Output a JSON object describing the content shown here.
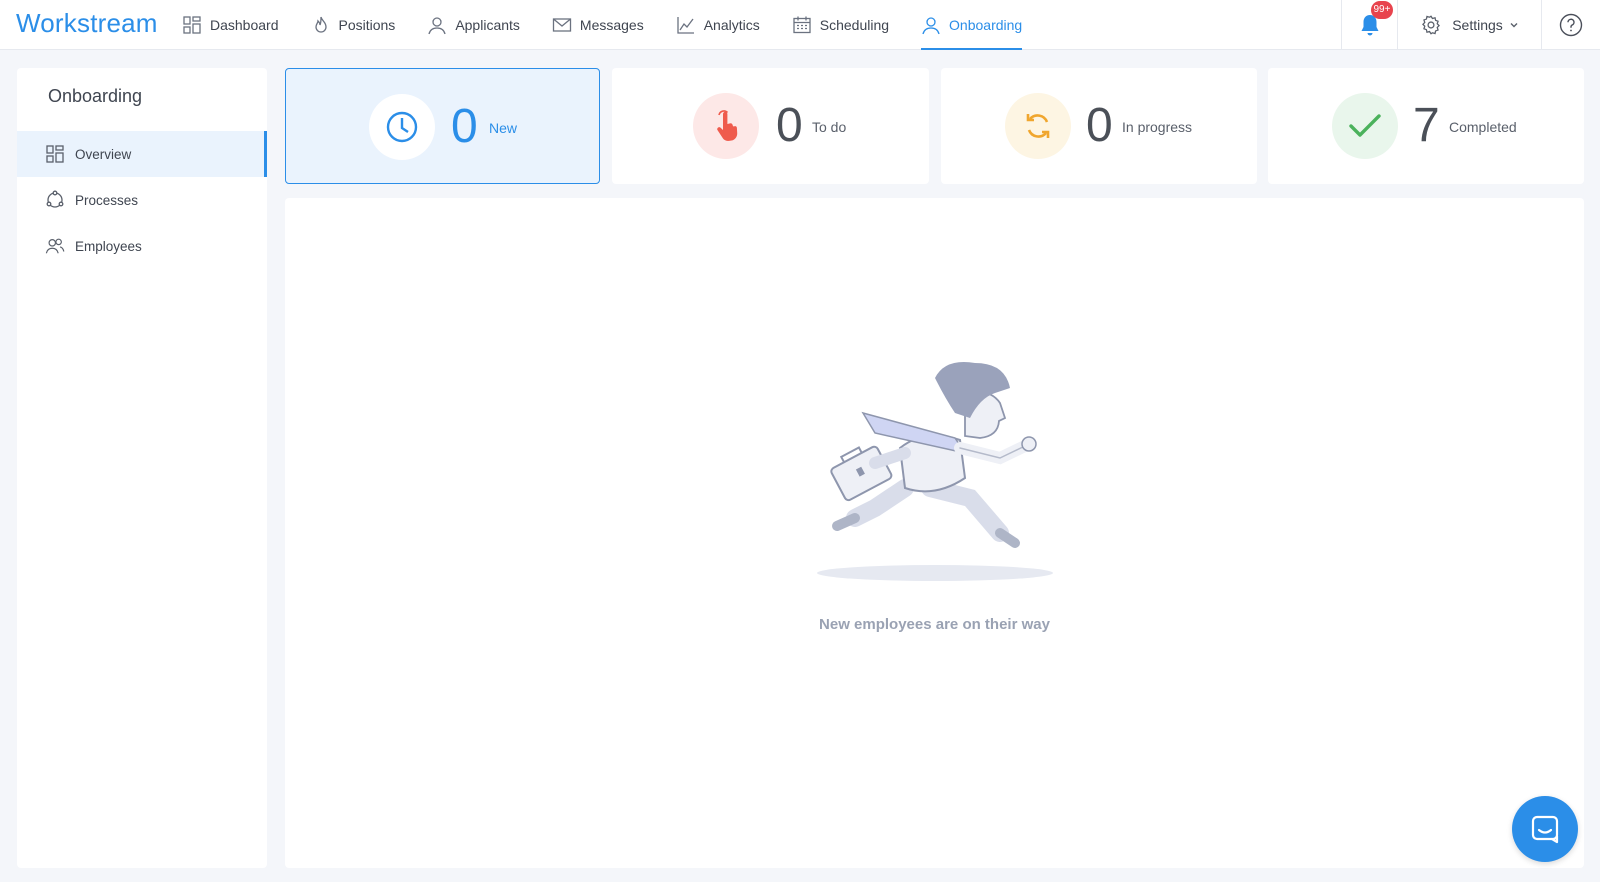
{
  "brand": {
    "logo_text": "Workstream"
  },
  "nav": {
    "items": [
      {
        "label": "Dashboard",
        "icon": "dashboard-icon"
      },
      {
        "label": "Positions",
        "icon": "flame-icon"
      },
      {
        "label": "Applicants",
        "icon": "person-icon"
      },
      {
        "label": "Messages",
        "icon": "envelope-icon"
      },
      {
        "label": "Analytics",
        "icon": "line-chart-icon"
      },
      {
        "label": "Scheduling",
        "icon": "calendar-icon"
      },
      {
        "label": "Onboarding",
        "icon": "person-icon",
        "active": true
      }
    ]
  },
  "header_right": {
    "notifications_badge": "99+",
    "settings_label": "Settings"
  },
  "sidebar": {
    "title": "Onboarding",
    "items": [
      {
        "label": "Overview",
        "icon": "grid-icon",
        "active": true
      },
      {
        "label": "Processes",
        "icon": "cycle-icon"
      },
      {
        "label": "Employees",
        "icon": "people-icon"
      }
    ]
  },
  "stats": [
    {
      "value": "0",
      "label": "New",
      "icon": "clock-icon",
      "color": "#2b8ee8"
    },
    {
      "value": "0",
      "label": "To do",
      "icon": "pointer-hand-icon",
      "color": "#ef5b4d"
    },
    {
      "value": "0",
      "label": "In progress",
      "icon": "refresh-icon",
      "color": "#f0a62e"
    },
    {
      "value": "7",
      "label": "Completed",
      "icon": "check-icon",
      "color": "#4bb25c"
    }
  ],
  "empty_state": {
    "caption": "New employees are on their way"
  },
  "colors": {
    "accent": "#2b8ee8",
    "page_bg": "#f4f6fa"
  }
}
